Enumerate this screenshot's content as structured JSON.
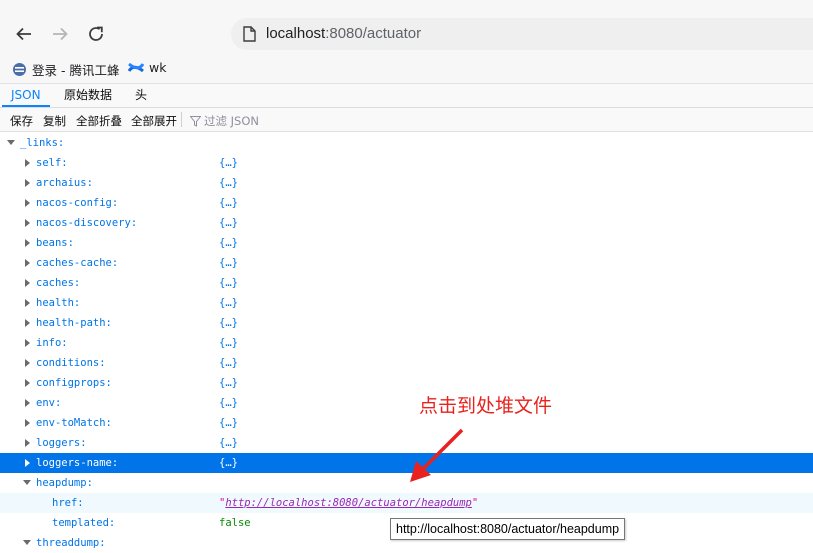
{
  "browser": {
    "url_host": "localhost",
    "url_rest": ":8080/actuator"
  },
  "bookmarks": [
    {
      "label": "登录 - 腾讯工蜂",
      "icon": "tencent-logo-icon"
    },
    {
      "label": "wk",
      "icon": "confluence-logo-icon"
    }
  ],
  "viewer_tabs": [
    "JSON",
    "原始数据",
    "头"
  ],
  "actions": {
    "save": "保存",
    "copy": "复制",
    "collapse_all": "全部折叠",
    "expand_all": "全部展开",
    "filter_placeholder": "过滤 JSON"
  },
  "tree": {
    "root_key": "_links:",
    "collapsed_marker": "{…}",
    "children": [
      "self:",
      "archaius:",
      "nacos-config:",
      "nacos-discovery:",
      "beans:",
      "caches-cache:",
      "caches:",
      "health:",
      "health-path:",
      "info:",
      "conditions:",
      "configprops:",
      "env:",
      "env-toMatch:",
      "loggers:",
      "loggers-name:"
    ],
    "selected_index": 15,
    "heapdump": {
      "key": "heapdump:",
      "href_key": "href:",
      "href_value": "http://localhost:8080/actuator/heapdump",
      "templated_key": "templated:",
      "templated_value": "false"
    },
    "next_key": "threaddump:"
  },
  "annotation": "点击到处堆文件",
  "tooltip": "http://localhost:8080/actuator/heapdump",
  "colors": {
    "selection": "#0074e8",
    "annotation": "#e8231f",
    "string": "#dd00a9",
    "boolean": "#058b00"
  }
}
